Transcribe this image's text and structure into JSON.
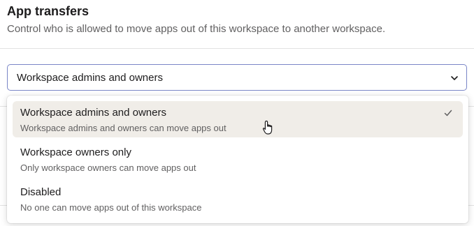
{
  "section": {
    "title": "App transfers",
    "description": "Control who is allowed to move apps out of this workspace to another workspace."
  },
  "select": {
    "value": "Workspace admins and owners"
  },
  "options": [
    {
      "title": "Workspace admins and owners",
      "description": "Workspace admins and owners can move apps out",
      "selected": true
    },
    {
      "title": "Workspace owners only",
      "description": "Only workspace owners can move apps out",
      "selected": false
    },
    {
      "title": "Disabled",
      "description": "No one can move apps out of this workspace",
      "selected": false
    }
  ],
  "icons": {
    "chevron": "chevron-down-icon",
    "check": "check-icon",
    "cursor": "hand-pointer-icon"
  },
  "colors": {
    "select_border": "#7a86c7",
    "selected_bg": "#f0ede8",
    "text_primary": "#1d1c1d",
    "text_secondary": "#616061"
  }
}
